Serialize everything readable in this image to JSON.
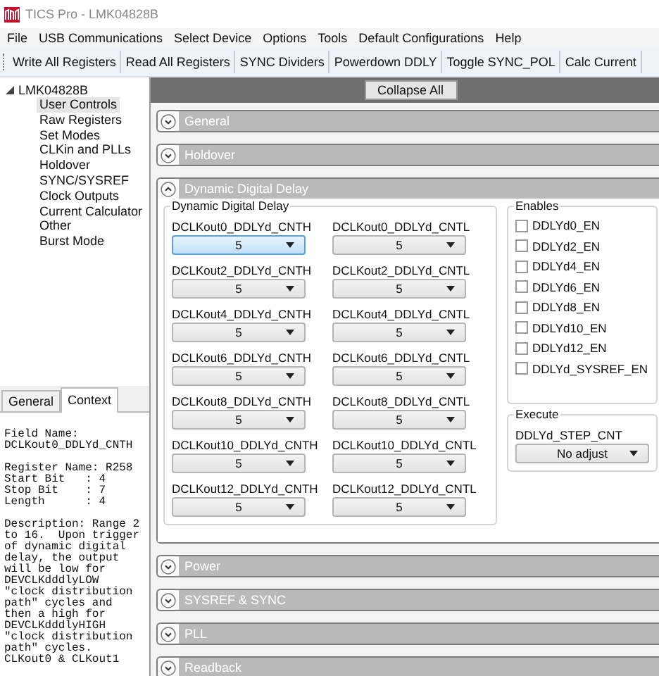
{
  "window": {
    "title": "TICS Pro - LMK04828B"
  },
  "menu": [
    "File",
    "USB Communications",
    "Select Device",
    "Options",
    "Tools",
    "Default Configurations",
    "Help"
  ],
  "toolbar": [
    "Write All Registers",
    "Read All Registers",
    "SYNC Dividers",
    "Powerdown DDLY",
    "Toggle SYNC_POL",
    "Calc Current"
  ],
  "tree": {
    "label": "LMK04828B",
    "expanded": true,
    "children": [
      {
        "label": "User Controls",
        "selected": true
      },
      {
        "label": "Raw Registers",
        "selected": false
      },
      {
        "label": "Set Modes",
        "selected": false
      },
      {
        "label": "CLKin and PLLs",
        "selected": false
      },
      {
        "label": "Holdover",
        "selected": false
      },
      {
        "label": "SYNC/SYSREF",
        "selected": false
      },
      {
        "label": "Clock Outputs",
        "selected": false
      },
      {
        "label": "Current Calculator",
        "selected": false
      },
      {
        "label": "Other",
        "selected": false
      },
      {
        "label": "Burst Mode",
        "selected": false
      }
    ]
  },
  "left_tabs": [
    {
      "label": "General",
      "selected": false
    },
    {
      "label": "Context",
      "selected": true
    }
  ],
  "context_blocks": [
    [
      "Field Name:",
      "DCLKout0_DDLYd_CNTH"
    ],
    [
      "Register Name: R258",
      "Start Bit   : 4",
      "Stop Bit    : 7",
      "Length      : 4"
    ],
    [
      "Description: Range 2",
      "to 16.  Upon trigger",
      "of dynamic digital",
      "delay, the output",
      "will be low for",
      "DEVCLKdddlyLOW",
      "\"clock distribution",
      "path\" cycles and",
      "then a high for",
      "DEVCLKdddlyHIGH",
      "\"clock distribution",
      "path\" cycles.",
      "CLKout0 & CLKout1"
    ]
  ],
  "collapse_button": "Collapse All",
  "sections": [
    {
      "title": "General",
      "expanded": false
    },
    {
      "title": "Holdover",
      "expanded": false
    },
    {
      "title": "Dynamic Digital Delay",
      "expanded": true,
      "content": {
        "delay_group": {
          "title": "Dynamic Digital Delay",
          "fields": [
            {
              "label": "DCLKout0_DDLYd_CNTH",
              "value": "5",
              "highlighted": true
            },
            {
              "label": "DCLKout0_DDLYd_CNTL",
              "value": "5",
              "highlighted": false
            },
            {
              "label": "DCLKout2_DDLYd_CNTH",
              "value": "5",
              "highlighted": false
            },
            {
              "label": "DCLKout2_DDLYd_CNTL",
              "value": "5",
              "highlighted": false
            },
            {
              "label": "DCLKout4_DDLYd_CNTH",
              "value": "5",
              "highlighted": false
            },
            {
              "label": "DCLKout4_DDLYd_CNTL",
              "value": "5",
              "highlighted": false
            },
            {
              "label": "DCLKout6_DDLYd_CNTH",
              "value": "5",
              "highlighted": false
            },
            {
              "label": "DCLKout6_DDLYd_CNTL",
              "value": "5",
              "highlighted": false
            },
            {
              "label": "DCLKout8_DDLYd_CNTH",
              "value": "5",
              "highlighted": false
            },
            {
              "label": "DCLKout8_DDLYd_CNTL",
              "value": "5",
              "highlighted": false
            },
            {
              "label": "DCLKout10_DDLYd_CNTH",
              "value": "5",
              "highlighted": false
            },
            {
              "label": "DCLKout10_DDLYd_CNTL",
              "value": "5",
              "highlighted": false
            },
            {
              "label": "DCLKout12_DDLYd_CNTH",
              "value": "5",
              "highlighted": false
            },
            {
              "label": "DCLKout12_DDLYd_CNTL",
              "value": "5",
              "highlighted": false
            }
          ]
        },
        "enables": {
          "title": "Enables",
          "items": [
            {
              "label": "DDLYd0_EN",
              "checked": false
            },
            {
              "label": "DDLYd2_EN",
              "checked": false
            },
            {
              "label": "DDLYd4_EN",
              "checked": false
            },
            {
              "label": "DDLYd6_EN",
              "checked": false
            },
            {
              "label": "DDLYd8_EN",
              "checked": false
            },
            {
              "label": "DDLYd10_EN",
              "checked": false
            },
            {
              "label": "DDLYd12_EN",
              "checked": false
            },
            {
              "label": "DDLYd_SYSREF_EN",
              "checked": false
            }
          ]
        },
        "execute": {
          "title": "Execute",
          "fields": [
            {
              "label": "DDLYd_STEP_CNT",
              "value": "No adjust",
              "highlighted": false
            }
          ]
        }
      }
    },
    {
      "title": "Power",
      "expanded": false
    },
    {
      "title": "SYSREF & SYNC",
      "expanded": false
    },
    {
      "title": "PLL",
      "expanded": false
    },
    {
      "title": "Readback",
      "expanded": false
    }
  ]
}
